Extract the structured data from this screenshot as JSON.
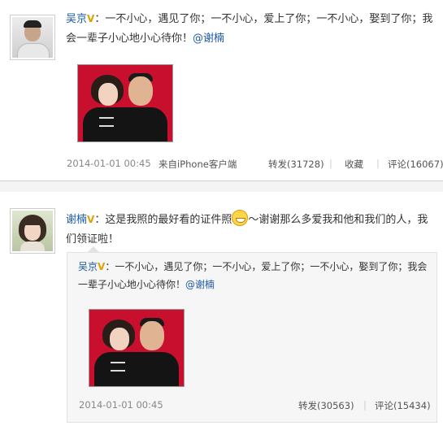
{
  "post1": {
    "author": "吴京",
    "text": "：一不小心，遇见了你；一不小心，爱上了你；一不小心，娶到了你；我会一辈子小心地小心待你！",
    "mention": "@谢楠",
    "time": "2014-01-01 00:45",
    "source": "来自iPhone客户端",
    "repost": "转发(31728)",
    "favorite": "收藏",
    "comment": "评论(16067)"
  },
  "post2": {
    "author": "谢楠",
    "text_before": "：这是我照的最好看的证件照",
    "text_after": "～谢谢那么多爱我和他和我们的人，我们领证啦！",
    "quoted": {
      "author": "吴京",
      "text": "：一不小心，遇见了你；一不小心，爱上了你；一不小心，娶到了你；我会一辈子小心地小心待你！",
      "mention": "@谢楠",
      "time": "2014-01-01 00:45",
      "repost": "转发(30563)",
      "comment": "评论(15434)"
    }
  },
  "icons": {
    "verified": "v-badge-icon",
    "emoji": "grin-emoji-icon"
  },
  "colors": {
    "link": "#1f5aa7",
    "badge": "#e0a100",
    "meta": "#888888"
  }
}
